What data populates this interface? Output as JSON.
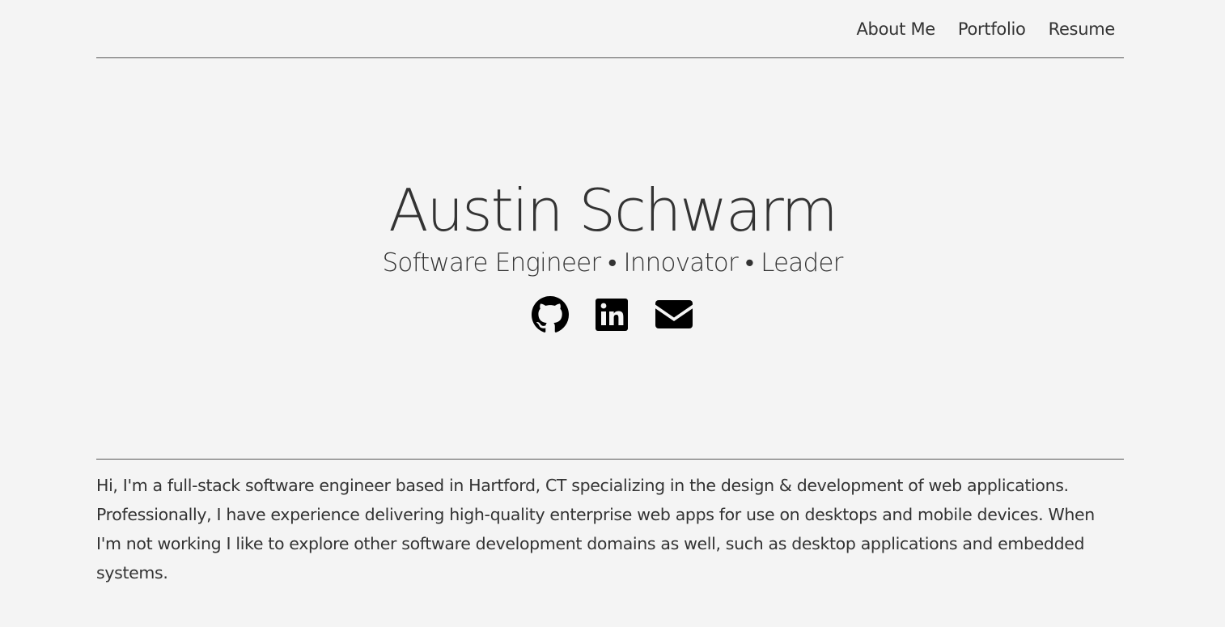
{
  "nav": {
    "items": [
      {
        "label": "About Me"
      },
      {
        "label": "Portfolio"
      },
      {
        "label": "Resume"
      }
    ]
  },
  "hero": {
    "name": "Austin Schwarm",
    "tagline": "Software Engineer • Innovator • Leader"
  },
  "social": {
    "icons": [
      "github-icon",
      "linkedin-icon",
      "email-icon"
    ]
  },
  "about": {
    "text": "Hi, I'm a full-stack software engineer based in Hartford, CT specializing in the design & development of web applications. Professionally, I have experience delivering high-quality enterprise web apps for use on desktops and mobile devices. When I'm not working I like to explore other software development domains as well, such as desktop applications and embedded systems."
  },
  "colors": {
    "background": "#f4f4f4",
    "text": "#333333",
    "rule": "#555555",
    "icon": "#000000"
  }
}
